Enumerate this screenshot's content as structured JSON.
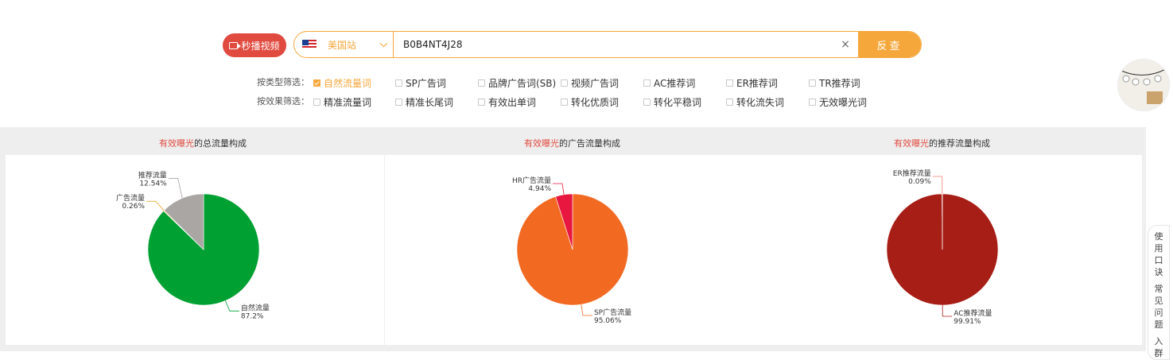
{
  "search": {
    "scan_label": "秒播视频",
    "site_label": "美国站",
    "query": "B0B4NT4J28",
    "clear_symbol": "×",
    "submit_label": "反查"
  },
  "filters": {
    "type_label": "按类型筛选：",
    "type_options": [
      {
        "label": "自然流量词",
        "checked": true
      },
      {
        "label": "SP广告词",
        "checked": false
      },
      {
        "label": "品牌广告词(SB)",
        "checked": false
      },
      {
        "label": "视频广告词",
        "checked": false
      },
      {
        "label": "AC推荐词",
        "checked": false
      },
      {
        "label": "ER推荐词",
        "checked": false
      },
      {
        "label": "TR推荐词",
        "checked": false
      }
    ],
    "effect_label": "按效果筛选：",
    "effect_options": [
      {
        "label": "精准流量词",
        "checked": false
      },
      {
        "label": "精准长尾词",
        "checked": false
      },
      {
        "label": "有效出单词",
        "checked": false
      },
      {
        "label": "转化优质词",
        "checked": false
      },
      {
        "label": "转化平稳词",
        "checked": false
      },
      {
        "label": "转化流失词",
        "checked": false
      },
      {
        "label": "无效曝光词",
        "checked": false
      }
    ]
  },
  "side": {
    "tab1": [
      "使",
      "用",
      "口",
      "诀"
    ],
    "tab2": [
      "常",
      "见",
      "问",
      "题"
    ],
    "tab3": [
      "入",
      "群"
    ]
  },
  "colors": {
    "accent": "#f5a73b",
    "red": "#e04a3f"
  },
  "chart_data": [
    {
      "type": "pie",
      "title_highlight": "有效曝光",
      "title_rest": "的总流量构成",
      "slices": [
        {
          "label": "自然流量",
          "value": 87.2,
          "value_label": "87.2%",
          "color": "#00a032"
        },
        {
          "label": "广告流量",
          "value": 0.26,
          "value_label": "0.26%",
          "color": "#e8a020"
        },
        {
          "label": "推荐流量",
          "value": 12.54,
          "value_label": "12.54%",
          "color": "#aaa6a4"
        }
      ]
    },
    {
      "type": "pie",
      "title_highlight": "有效曝光",
      "title_rest": "的广告流量构成",
      "slices": [
        {
          "label": "SP广告流量",
          "value": 95.06,
          "value_label": "95.06%",
          "color": "#f26922"
        },
        {
          "label": "HR广告流量",
          "value": 4.94,
          "value_label": "4.94%",
          "color": "#e8173f"
        }
      ]
    },
    {
      "type": "pie",
      "title_highlight": "有效曝光",
      "title_rest": "的推荐流量构成",
      "slices": [
        {
          "label": "AC推荐流量",
          "value": 99.91,
          "value_label": "99.91%",
          "color": "#a61e16"
        },
        {
          "label": "ER推荐流量",
          "value": 0.09,
          "value_label": "0.09%",
          "color": "#f08070"
        }
      ]
    }
  ]
}
